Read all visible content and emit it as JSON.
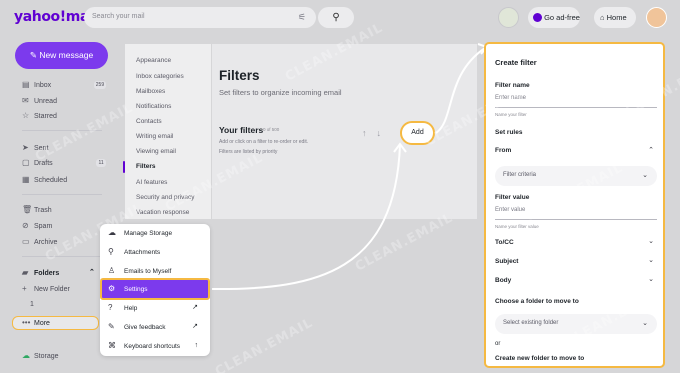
{
  "header": {
    "logo": "yahoo!mail",
    "search_placeholder": "Search your mail",
    "go_ad_free": "Go ad-free",
    "home": "Home"
  },
  "sidebar": {
    "new_message": "New message",
    "items": [
      {
        "label": "Inbox",
        "count": "259",
        "icon": "inbox-icon"
      },
      {
        "label": "Unread",
        "icon": "mail-icon"
      },
      {
        "label": "Starred",
        "icon": "star-icon"
      },
      {
        "label": "Sent",
        "icon": "send-icon"
      },
      {
        "label": "Drafts",
        "count": "11",
        "icon": "draft-icon"
      },
      {
        "label": "Scheduled",
        "icon": "calendar-icon"
      },
      {
        "label": "Trash",
        "icon": "trash-icon"
      },
      {
        "label": "Spam",
        "icon": "spam-icon"
      },
      {
        "label": "Archive",
        "icon": "archive-icon"
      }
    ],
    "folders": "Folders",
    "new_folder": "New Folder",
    "folder_one": "1",
    "more": "More",
    "storage": "Storage"
  },
  "settings_menu": {
    "items": [
      "Appearance",
      "Inbox categories",
      "Mailboxes",
      "Notifications",
      "Contacts",
      "Writing email",
      "Viewing email",
      "Filters",
      "AI features",
      "Security and privacy",
      "Vacation response"
    ],
    "active": "Filters"
  },
  "filters": {
    "title": "Filters",
    "subtitle": "Set filters to organize incoming email",
    "your_filters": "Your filters",
    "count": "0 of 500",
    "hint1": "Add or click on a filter to re-order or edit.",
    "hint2": "Filters are listed by priority",
    "add": "Add"
  },
  "more_popup": {
    "items": [
      {
        "label": "Manage Storage",
        "icon": "cloud-icon"
      },
      {
        "label": "Attachments",
        "icon": "paperclip-icon"
      },
      {
        "label": "Emails to Myself",
        "icon": "person-icon"
      },
      {
        "label": "Settings",
        "icon": "gear-icon"
      },
      {
        "label": "Help",
        "icon": "help-icon",
        "external": "↗"
      },
      {
        "label": "Give feedback",
        "icon": "feedback-icon",
        "external": "↗"
      },
      {
        "label": "Keyboard shortcuts",
        "icon": "keyboard-icon",
        "external": "↑"
      }
    ]
  },
  "create_filter": {
    "title": "Create filter",
    "filter_name_label": "Filter name",
    "filter_name_placeholder": "Enter name",
    "filter_name_hint": "Name your filter",
    "set_rules": "Set rules",
    "from": "From",
    "filter_criteria": "Filter criteria",
    "filter_value_label": "Filter value",
    "filter_value_placeholder": "Enter value",
    "filter_value_hint": "Name your filter value",
    "to_cc": "To/CC",
    "subject": "Subject",
    "body": "Body",
    "choose_folder": "Choose a folder to move to",
    "select_folder": "Select existing folder",
    "or": "or",
    "create_new_folder": "Create new folder to move to"
  },
  "watermark": "CLEAN.EMAIL",
  "colors": {
    "accent": "#7c3aed",
    "highlight": "#f5b942",
    "brand": "#6001d2"
  }
}
